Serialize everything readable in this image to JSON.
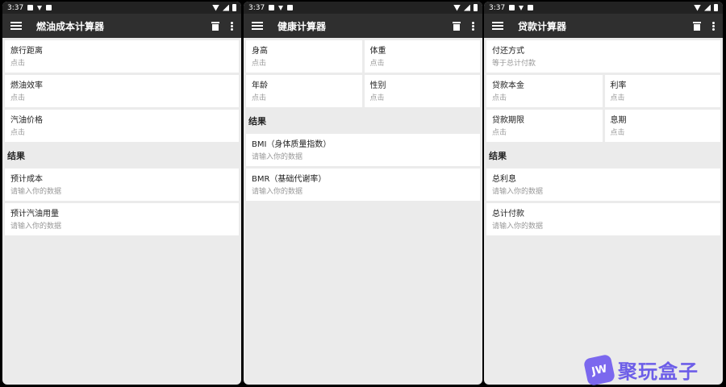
{
  "status_time": "3:37",
  "screens": [
    {
      "title": "燃油成本计算器",
      "inputs": [
        {
          "label": "旅行距离",
          "hint": "点击"
        },
        {
          "label": "燃油效率",
          "hint": "点击"
        },
        {
          "label": "汽油价格",
          "hint": "点击"
        }
      ],
      "results_title": "结果",
      "results": [
        {
          "label": "预计成本",
          "hint": "请输入你的数据"
        },
        {
          "label": "预计汽油用量",
          "hint": "请输入你的数据"
        }
      ]
    },
    {
      "title": "健康计算器",
      "inputs": [
        {
          "label": "身高",
          "hint": "点击"
        },
        {
          "label": "体重",
          "hint": "点击"
        },
        {
          "label": "年龄",
          "hint": "点击"
        },
        {
          "label": "性别",
          "hint": "点击"
        }
      ],
      "results_title": "结果",
      "results": [
        {
          "label": "BMI（身体质量指数）",
          "hint": "请输入你的数据"
        },
        {
          "label": "BMR（基础代谢率）",
          "hint": "请输入你的数据"
        }
      ]
    },
    {
      "title": "贷款计算器",
      "inputs": [
        {
          "label": "付还方式",
          "hint": "等于总计付款"
        },
        {
          "label": "贷款本金",
          "hint": "点击"
        },
        {
          "label": "利率",
          "hint": "点击"
        },
        {
          "label": "贷款期限",
          "hint": "点击"
        },
        {
          "label": "息期",
          "hint": "点击"
        }
      ],
      "results_title": "结果",
      "results": [
        {
          "label": "总利息",
          "hint": "请输入你的数据"
        },
        {
          "label": "总计付款",
          "hint": "请输入你的数据"
        }
      ]
    }
  ],
  "watermark": {
    "badge": "JW",
    "text": "聚玩盒子"
  },
  "colors": {
    "appbar": "#2f2f2f",
    "statusbar": "#222222",
    "background": "#ebebeb",
    "watermark": "#6d5ee8"
  }
}
